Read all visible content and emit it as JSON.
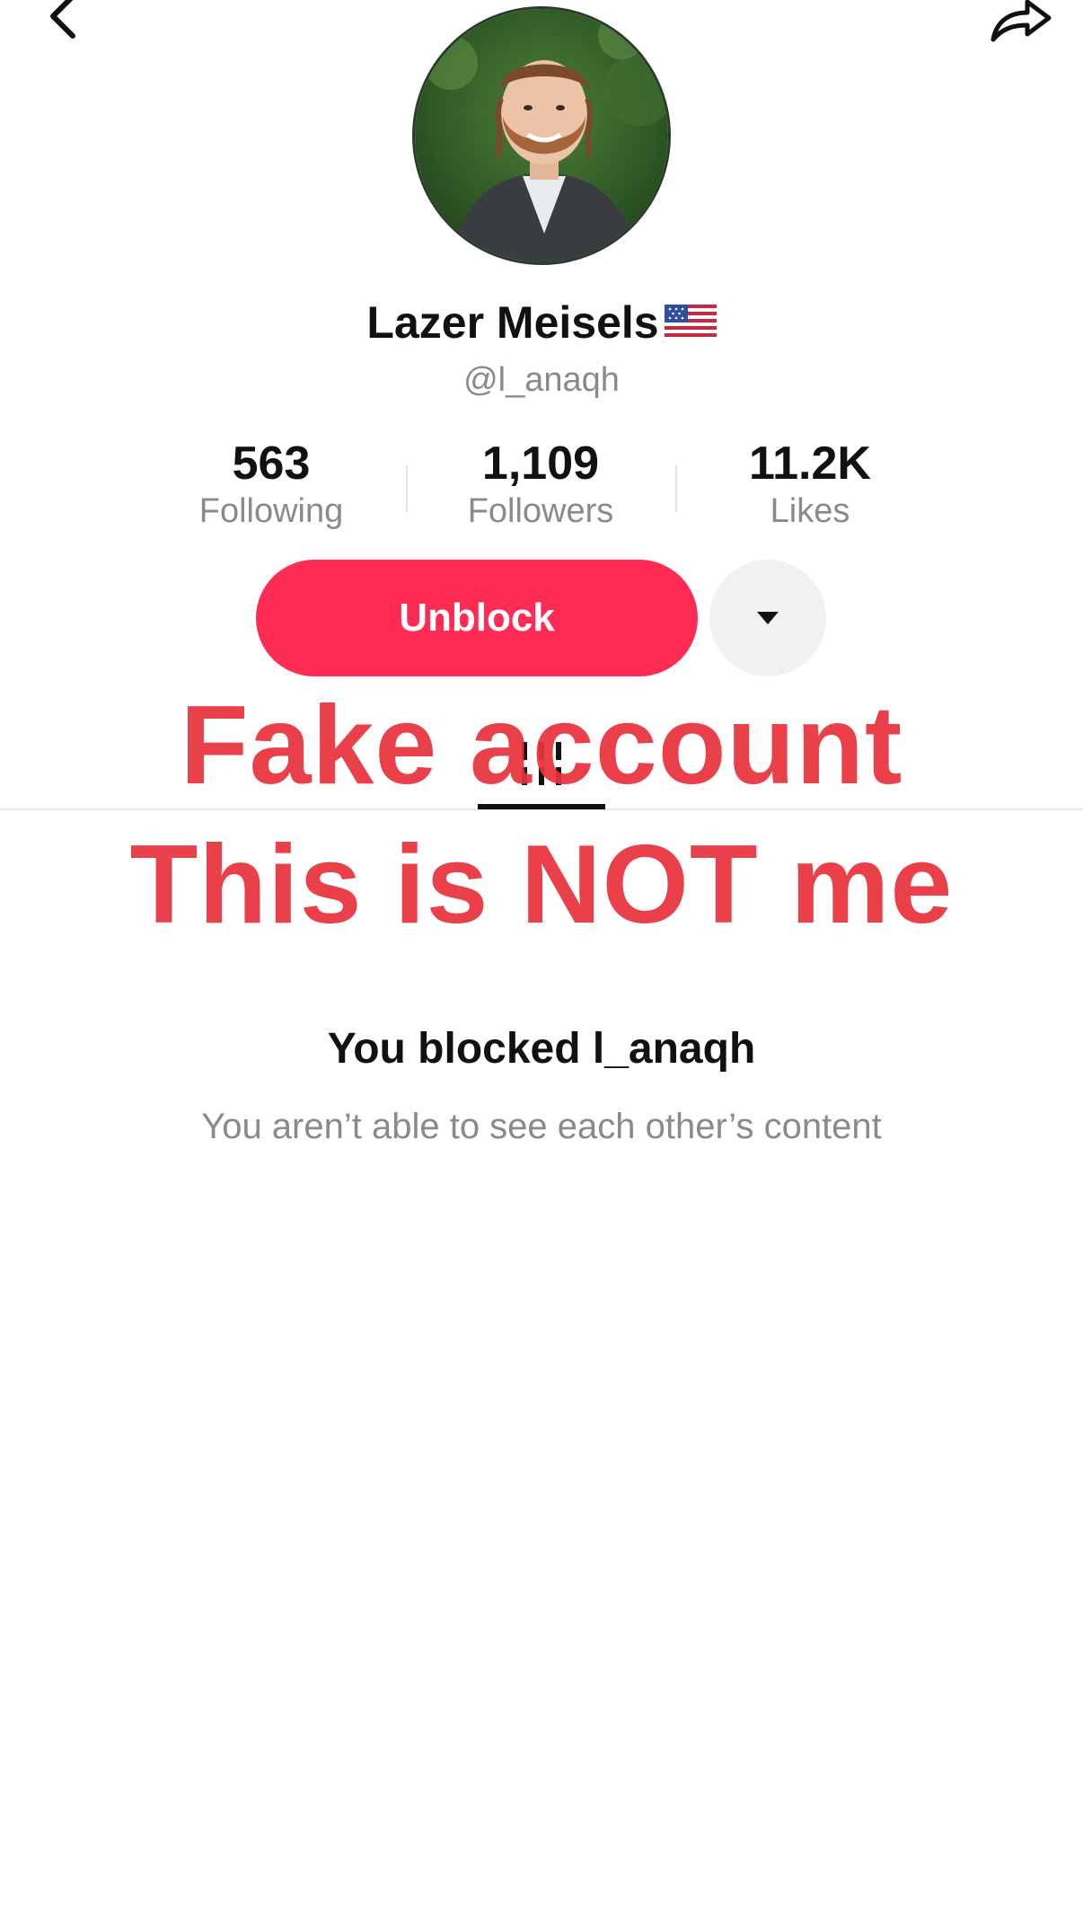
{
  "nav": {
    "back_icon": "chevron-left-icon",
    "share_icon": "share-arrow-icon"
  },
  "profile": {
    "display_name": "Lazer Meisels",
    "flag_icon": "us-flag-icon",
    "handle": "@l_anaqh"
  },
  "stats": [
    {
      "value": "563",
      "label": "Following"
    },
    {
      "value": "1,109",
      "label": "Followers"
    },
    {
      "value": "11.2K",
      "label": "Likes"
    }
  ],
  "actions": {
    "unblock_label": "Unblock",
    "more_icon": "caret-down-icon"
  },
  "tabs": {
    "grid_icon": "grid-videos-icon"
  },
  "overlay": {
    "line1": "Fake account",
    "line2": "This is NOT me",
    "color": "#e8323c"
  },
  "blocked": {
    "title": "You blocked l_anaqh",
    "subtitle": "You aren’t able to see each other’s content"
  },
  "colors": {
    "accent": "#fe2c55",
    "secondary_text": "#8a8a8a"
  }
}
